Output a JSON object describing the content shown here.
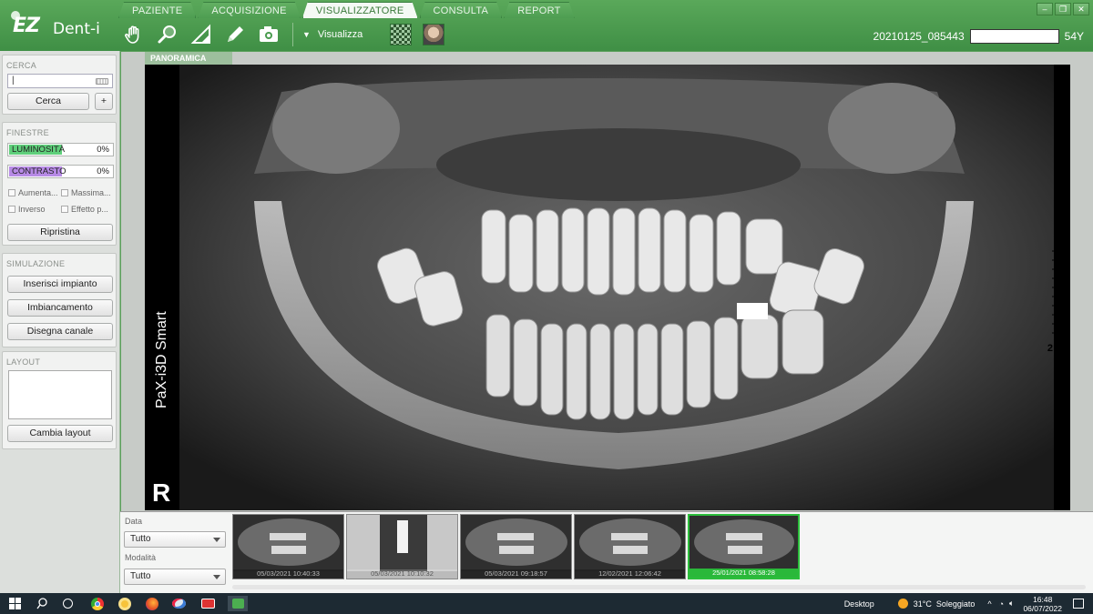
{
  "app": {
    "logo_ez": "EZ",
    "logo_dent": "Dent-i",
    "tabs": [
      "PAZIENTE",
      "ACQUISIZIONE",
      "VISUALIZZATORE",
      "CONSULTA",
      "REPORT"
    ],
    "active_tab": "VISUALIZZATORE",
    "toolbar": {
      "tools": [
        "hand-icon",
        "magnifier-icon",
        "ruler-triangle-icon",
        "pencil-icon",
        "camera-icon"
      ],
      "visualizza_label": "Visualizza"
    },
    "patient": {
      "id": "20210125_085443",
      "age": "54Y"
    },
    "window_controls": [
      "minimize-icon",
      "restore-icon",
      "close-icon"
    ]
  },
  "sidebar": {
    "cerca": {
      "title": "CERCA",
      "search_value": "|",
      "search_button": "Cerca",
      "plus_button": "+"
    },
    "finestre": {
      "title": "FINESTRE",
      "luminosita_label": "LUMINOSITÀ",
      "luminosita_value": "0%",
      "luminosita_fill": 0.5,
      "contrasto_label": "CONTRASTO",
      "contrasto_value": "0%",
      "contrasto_fill": 0.5,
      "checks": [
        "Aumenta...",
        "Massima...",
        "Inverso",
        "Effetto p..."
      ],
      "reset_button": "Ripristina"
    },
    "simulazione": {
      "title": "SIMULAZIONE",
      "buttons": [
        "Inserisci impianto",
        "Imbiancamento",
        "Disegna canale"
      ]
    },
    "layout": {
      "title": "LAYOUT",
      "button": "Cambia layout"
    }
  },
  "viewer": {
    "label": "PANORAMICA",
    "device": "PaX-i3D Smart",
    "side": "R",
    "scale": "2 cm"
  },
  "filters": {
    "data_label": "Data",
    "data_value": "Tutto",
    "modalita_label": "Modalità",
    "modalita_value": "Tutto"
  },
  "thumbnails": [
    {
      "caption": "05/03/2021 10:40:33",
      "kind": "pano"
    },
    {
      "caption": "05/03/2021 10:10:32",
      "kind": "implant"
    },
    {
      "caption": "05/03/2021 09:18:57",
      "kind": "pano"
    },
    {
      "caption": "12/02/2021 12:06:42",
      "kind": "pano"
    },
    {
      "caption": "25/01/2021 08:58:28",
      "kind": "pano",
      "selected": true
    }
  ],
  "taskbar": {
    "desktop": "Desktop",
    "weather": "31°C  Soleggiato",
    "time": "16:48",
    "date": "06/07/2022"
  },
  "colors": {
    "brand": "#4a9c4f",
    "selected": "#2cbf3c",
    "luminosita": "#5fcf7b",
    "contrasto": "#b78ae6"
  }
}
